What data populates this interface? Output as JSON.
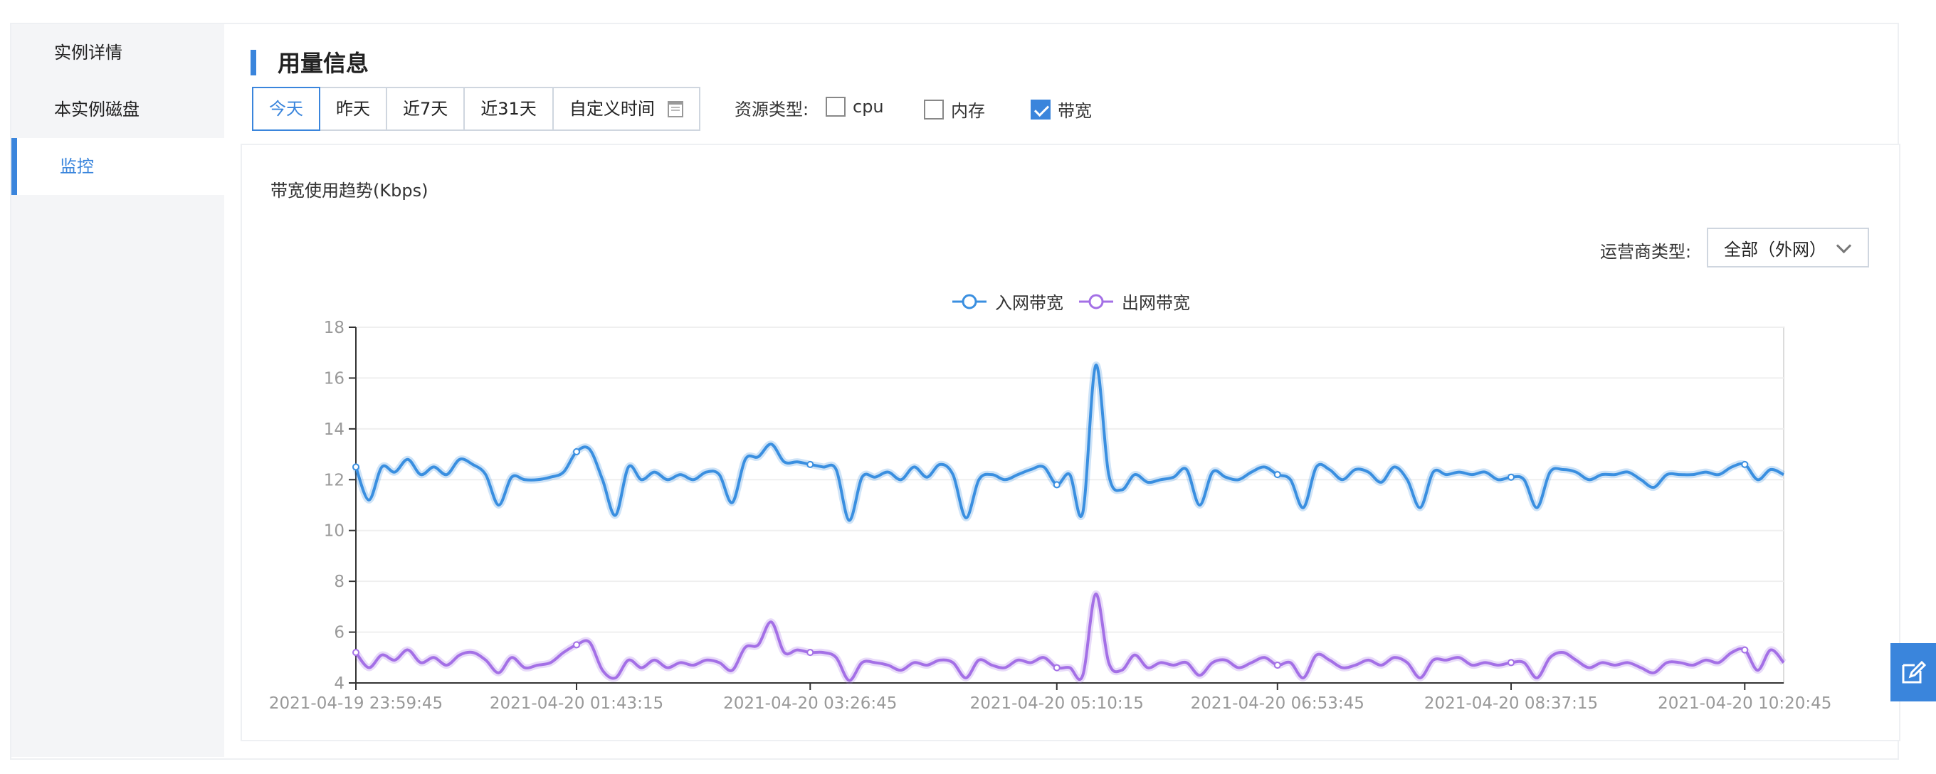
{
  "sidebar": {
    "items": [
      {
        "label": "实例详情",
        "active": false
      },
      {
        "label": "本实例磁盘",
        "active": false
      },
      {
        "label": "监控",
        "active": true
      }
    ]
  },
  "header": {
    "title": "用量信息"
  },
  "time_tabs": [
    {
      "label": "今天",
      "active": true
    },
    {
      "label": "昨天",
      "active": false
    },
    {
      "label": "近7天",
      "active": false
    },
    {
      "label": "近31天",
      "active": false
    },
    {
      "label": "自定义时间",
      "active": false,
      "icon": "calendar-icon"
    }
  ],
  "resource": {
    "label": "资源类型:",
    "options": [
      {
        "label": "cpu",
        "checked": false
      },
      {
        "label": "内存",
        "checked": false
      },
      {
        "label": "带宽",
        "checked": true
      }
    ]
  },
  "isp": {
    "label": "运营商类型:",
    "selected": "全部（外网）"
  },
  "float_button_icon": "edit-icon",
  "colors": {
    "accent": "#3a85dc",
    "in_series": "#3a8fe0",
    "out_series": "#a470e6"
  },
  "chart_data": {
    "type": "line",
    "title": "带宽使用趋势(Kbps)",
    "ylim": [
      4,
      18
    ],
    "yticks": [
      4,
      6,
      8,
      10,
      12,
      14,
      16,
      18
    ],
    "xtick_labels": [
      "2021-04-19 23:59:45",
      "2021-04-20 01:43:15",
      "2021-04-20 03:26:45",
      "2021-04-20 05:10:15",
      "2021-04-20 06:53:45",
      "2021-04-20 08:37:15",
      "2021-04-20 10:20:45"
    ],
    "x_unit_note": "",
    "legend_position": "top-center",
    "grid": true,
    "series": [
      {
        "name": "入网带宽",
        "color": "#3a8fe0",
        "values": [
          12.5,
          11.2,
          12.5,
          12.3,
          12.8,
          12.2,
          12.5,
          12.2,
          12.8,
          12.6,
          12.2,
          11.0,
          12.1,
          12.0,
          12.0,
          12.1,
          12.3,
          13.1,
          13.2,
          12.0,
          10.6,
          12.5,
          12.0,
          12.3,
          12.0,
          12.2,
          12.0,
          12.3,
          12.2,
          11.1,
          12.8,
          12.9,
          13.4,
          12.7,
          12.7,
          12.6,
          12.5,
          12.4,
          10.4,
          12.1,
          12.1,
          12.3,
          12.0,
          12.5,
          12.1,
          12.6,
          12.2,
          10.5,
          12.0,
          12.2,
          12.0,
          12.2,
          12.4,
          12.5,
          11.8,
          12.2,
          10.7,
          16.5,
          12.2,
          11.6,
          12.2,
          11.9,
          12.0,
          12.1,
          12.4,
          11.0,
          12.3,
          12.1,
          12.0,
          12.3,
          12.5,
          12.2,
          12.0,
          10.9,
          12.5,
          12.4,
          12.0,
          12.4,
          12.3,
          11.9,
          12.5,
          12.0,
          10.9,
          12.3,
          12.2,
          12.3,
          12.2,
          12.3,
          12.0,
          12.1,
          12.0,
          10.9,
          12.3,
          12.4,
          12.3,
          12.0,
          12.2,
          12.2,
          12.3,
          12.0,
          11.7,
          12.2,
          12.2,
          12.2,
          12.3,
          12.2,
          12.5,
          12.6,
          12.0,
          12.4,
          12.2
        ],
        "markers_at": [
          0,
          17,
          35,
          54,
          71,
          89,
          107
        ]
      },
      {
        "name": "出网带宽",
        "color": "#a470e6",
        "values": [
          5.2,
          4.6,
          5.1,
          4.9,
          5.3,
          4.8,
          5.0,
          4.7,
          5.1,
          5.2,
          4.9,
          4.4,
          5.0,
          4.6,
          4.7,
          4.8,
          5.2,
          5.5,
          5.6,
          4.5,
          4.2,
          4.9,
          4.6,
          4.9,
          4.6,
          4.8,
          4.7,
          4.9,
          4.8,
          4.5,
          5.4,
          5.5,
          6.4,
          5.2,
          5.3,
          5.2,
          5.2,
          5.0,
          4.1,
          4.8,
          4.8,
          4.7,
          4.5,
          4.8,
          4.7,
          4.9,
          4.8,
          4.2,
          4.9,
          4.7,
          4.6,
          4.9,
          4.8,
          5.0,
          4.6,
          4.6,
          4.3,
          7.5,
          4.8,
          4.5,
          5.1,
          4.6,
          4.8,
          4.7,
          4.8,
          4.3,
          4.8,
          4.9,
          4.6,
          4.8,
          5.0,
          4.7,
          4.8,
          4.2,
          5.1,
          4.9,
          4.6,
          4.7,
          4.9,
          4.7,
          5.0,
          4.8,
          4.2,
          4.9,
          4.9,
          5.0,
          4.7,
          4.8,
          4.7,
          4.8,
          4.8,
          4.2,
          5.0,
          5.2,
          4.9,
          4.6,
          4.8,
          4.7,
          4.8,
          4.6,
          4.4,
          4.8,
          4.8,
          4.7,
          4.9,
          4.8,
          5.2,
          5.3,
          4.5,
          5.3,
          4.8
        ],
        "markers_at": [
          0,
          17,
          35,
          54,
          71,
          89,
          107
        ]
      }
    ]
  }
}
